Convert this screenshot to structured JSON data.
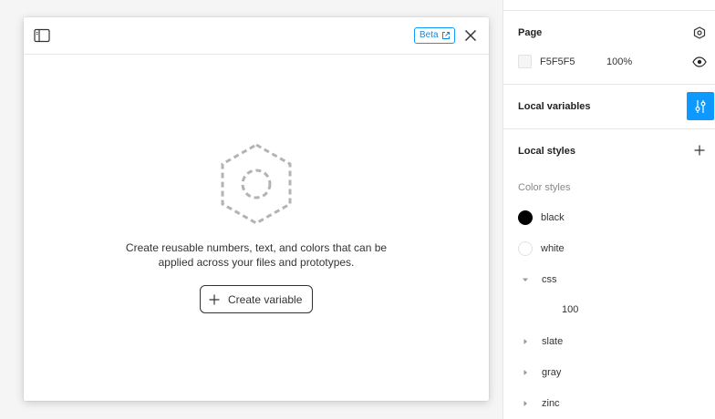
{
  "modal": {
    "beta_label": "Beta",
    "empty_text_line1": "Create reusable numbers, text, and colors that can be",
    "empty_text_line2": "applied across your files and prototypes.",
    "create_button_label": "Create variable"
  },
  "panel": {
    "page": {
      "title": "Page",
      "color_hex": "F5F5F5",
      "opacity": "100%",
      "swatch_color": "#f5f5f5"
    },
    "local_variables": {
      "title": "Local variables"
    },
    "local_styles": {
      "title": "Local styles",
      "color_styles_label": "Color styles",
      "styles": [
        {
          "label": "black",
          "color": "#000000"
        },
        {
          "label": "white",
          "color": "#ffffff"
        }
      ],
      "groups": [
        {
          "label": "css",
          "expanded": true,
          "children": [
            {
              "label": "100"
            }
          ]
        },
        {
          "label": "slate",
          "expanded": false
        },
        {
          "label": "gray",
          "expanded": false
        },
        {
          "label": "zinc",
          "expanded": false
        }
      ]
    }
  },
  "colors": {
    "accent": "#0d99ff",
    "background": "#f5f5f5"
  }
}
